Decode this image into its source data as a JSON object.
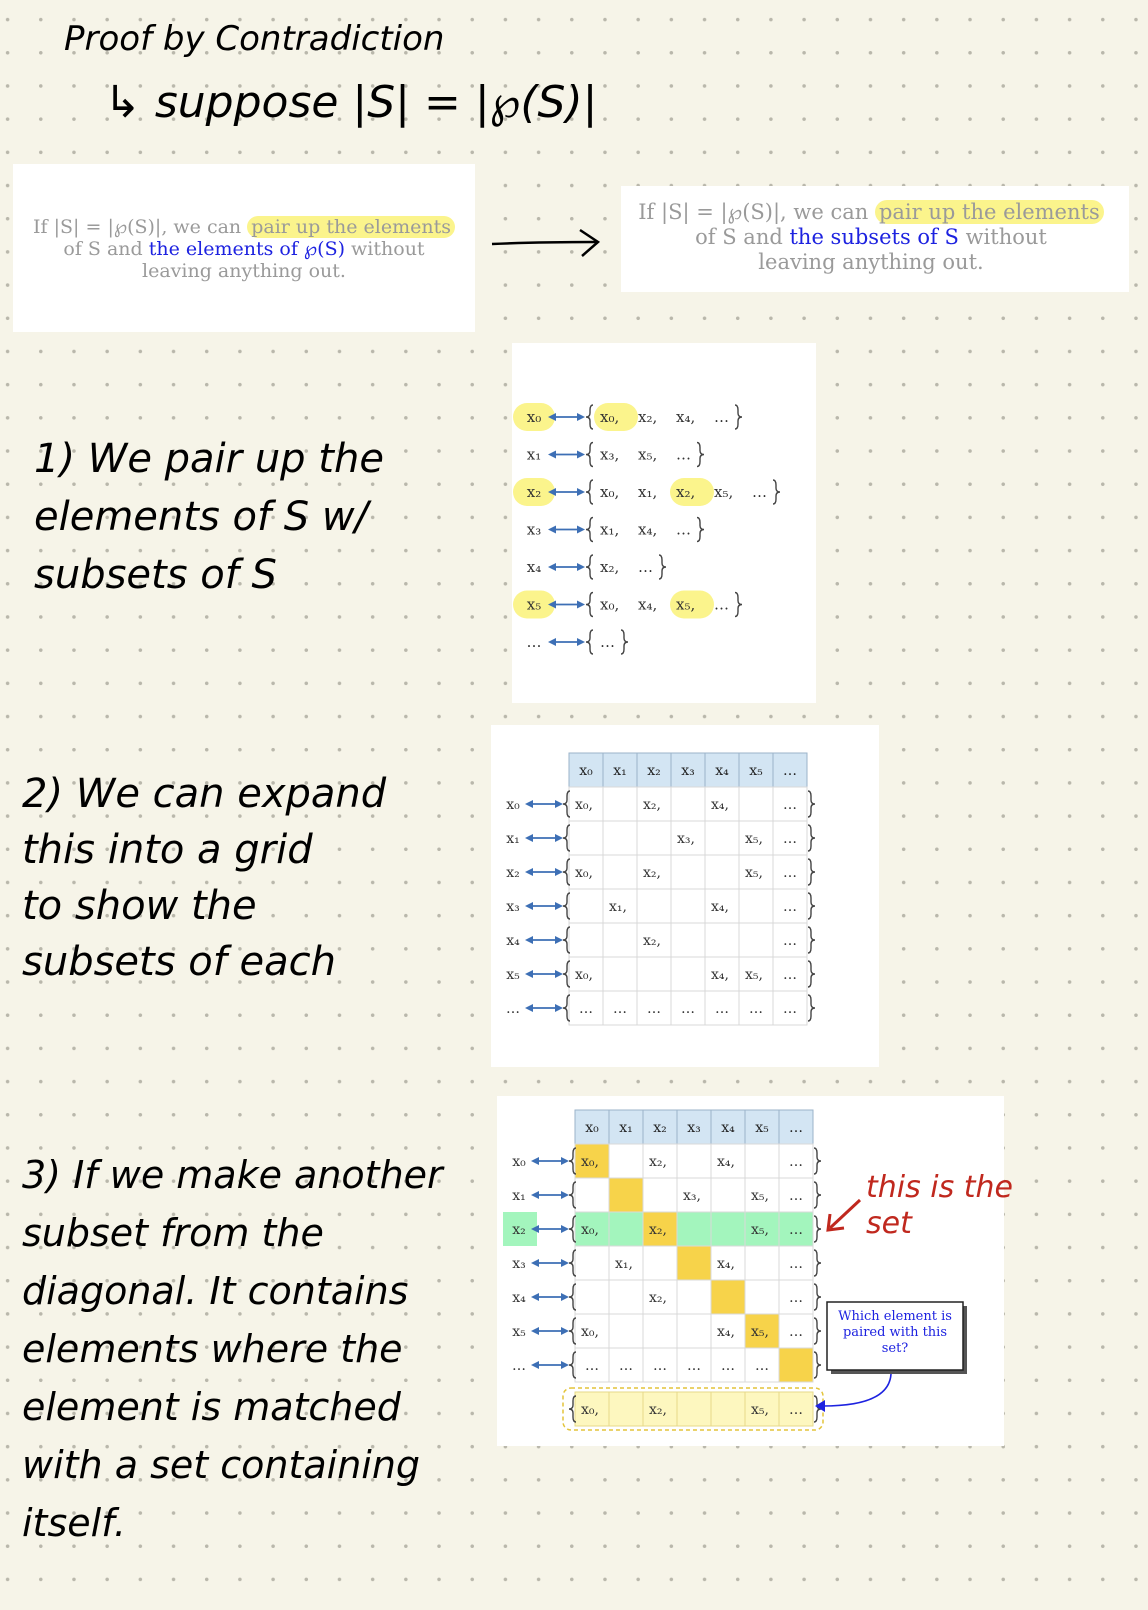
{
  "notes": {
    "title": "Proof by Contradiction",
    "suppose": "↳ suppose |S| = |℘(S)|",
    "step1": "1) We pair up the\nelements of S w/\nsubsets of S",
    "step2": "2) We can expand\nthis into a grid\nto show the\nsubsets of each",
    "step3": "3) If we make another\nsubset from the\ndiagonal. It contains\nelements where the\nelement is matched\nwith a set containing\nitself.",
    "annotation": "this is the\nset"
  },
  "quote_before": {
    "l1a": "If |S| = |℘(S)|, we can",
    "l1b": "pair up the elements",
    "l2a": "of S and",
    "l2b": "the elements of ℘(S)",
    "l2c": "without",
    "l3": "leaving anything out."
  },
  "quote_after": {
    "l1a": "If |S| = |℘(S)|, we can",
    "l1b": "pair up the elements",
    "l2a": "of S and",
    "l2b": "the subsets of S",
    "l2c": "without",
    "l3": "leaving anything out."
  },
  "pairing": {
    "rows": [
      {
        "label": "x₀",
        "items": [
          "x₀,",
          "x₂,",
          "x₄,",
          "…"
        ]
      },
      {
        "label": "x₁",
        "items": [
          "x₃,",
          "x₅,",
          "…"
        ]
      },
      {
        "label": "x₂",
        "items": [
          "x₀,",
          "x₁,",
          "x₂,",
          "x₅,",
          "…"
        ]
      },
      {
        "label": "x₃",
        "items": [
          "x₁,",
          "x₄,",
          "…"
        ]
      },
      {
        "label": "x₄",
        "items": [
          "x₂,",
          "…"
        ]
      },
      {
        "label": "x₅",
        "items": [
          "x₀,",
          "x₄,",
          "x₅,",
          "…"
        ]
      },
      {
        "label": "…",
        "items": [
          "…"
        ]
      }
    ]
  },
  "grid": {
    "headers": [
      "x₀",
      "x₁",
      "x₂",
      "x₃",
      "x₄",
      "x₅",
      "…"
    ],
    "rows": [
      {
        "label": "x₀",
        "cells": [
          "x₀,",
          "",
          "x₂,",
          "",
          "x₄,",
          "",
          "…"
        ]
      },
      {
        "label": "x₁",
        "cells": [
          "",
          "",
          "",
          "x₃,",
          "",
          "x₅,",
          "…"
        ]
      },
      {
        "label": "x₂",
        "cells": [
          "x₀,",
          "",
          "x₂,",
          "",
          "",
          "x₅,",
          "…"
        ]
      },
      {
        "label": "x₃",
        "cells": [
          "",
          "x₁,",
          "",
          "",
          "x₄,",
          "",
          "…"
        ]
      },
      {
        "label": "x₄",
        "cells": [
          "",
          "",
          "x₂,",
          "",
          "",
          "",
          "…"
        ]
      },
      {
        "label": "x₅",
        "cells": [
          "x₀,",
          "",
          "",
          "",
          "x₄,",
          "x₅,",
          "…"
        ]
      },
      {
        "label": "…",
        "cells": [
          "…",
          "…",
          "…",
          "…",
          "…",
          "…",
          "…"
        ]
      }
    ]
  },
  "diagonal_grid": {
    "rows": [
      {
        "label": "x₀",
        "cells": [
          "x₀,",
          "",
          "x₂,",
          "",
          "x₄,",
          "",
          "…"
        ]
      },
      {
        "label": "x₁",
        "cells": [
          "",
          "",
          "",
          "x₃,",
          "",
          "x₅,",
          "…"
        ]
      },
      {
        "label": "x₂",
        "cells": [
          "x₀,",
          "",
          "x₂,",
          "",
          "",
          "x₅,",
          "…"
        ]
      },
      {
        "label": "x₃",
        "cells": [
          "",
          "x₁,",
          "",
          "",
          "x₄,",
          "",
          "…"
        ]
      },
      {
        "label": "x₄",
        "cells": [
          "",
          "",
          "x₂,",
          "",
          "",
          "",
          "…"
        ]
      },
      {
        "label": "x₅",
        "cells": [
          "x₀,",
          "",
          "",
          "",
          "x₄,",
          "x₅,",
          "…"
        ]
      },
      {
        "label": "…",
        "cells": [
          "…",
          "…",
          "…",
          "…",
          "…",
          "…",
          ""
        ]
      }
    ],
    "new_set": [
      "x₀,",
      "",
      "x₂,",
      "",
      "",
      "x₅,",
      "…"
    ],
    "callout": "Which element is\npaired with this\nset?"
  },
  "colors": {
    "highlight_yellow": "#fbf48c",
    "diagonal_gold": "#f7d34a",
    "row_green": "#a3f5bd",
    "header_blue": "#d3e5f3",
    "arrow_blue": "#3d6fb5",
    "annotation_red": "#c0281e",
    "link_blue": "#1d22e0"
  }
}
